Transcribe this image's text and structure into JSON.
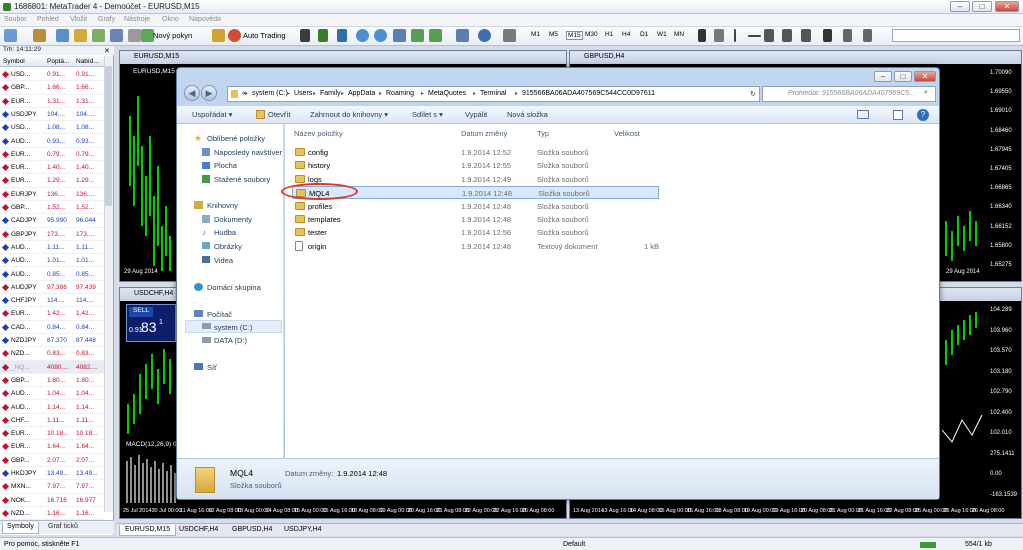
{
  "window": {
    "title": "1686801: MetaTrader 4 - Demoúčet - EURUSD,M15",
    "min": "–",
    "max": "□",
    "close": "✕"
  },
  "menu": [
    "Soubor",
    "Pohled",
    "Vložit",
    "Grafy",
    "Nástroje",
    "Okno",
    "Nápověda"
  ],
  "toolbar": {
    "new_order": "Nový pokyn",
    "auto_trading": "Auto Trading",
    "timeframes": [
      "M1",
      "M5",
      "M15",
      "M30",
      "H1",
      "H4",
      "D1",
      "W1",
      "MN"
    ]
  },
  "market_watch": {
    "header": "Trh: 14:11:29",
    "columns": [
      "Symbol",
      "Poptá...",
      "Nabíd..."
    ],
    "rows": [
      {
        "sym": "USD...",
        "bid": "0.91...",
        "ask": "0.91...",
        "c": "#c8102e"
      },
      {
        "sym": "GBP...",
        "bid": "1.66...",
        "ask": "1.66...",
        "c": "#c8102e"
      },
      {
        "sym": "EUR...",
        "bid": "1.31...",
        "ask": "1.31...",
        "c": "#c8102e"
      },
      {
        "sym": "USDJPY",
        "bid": "104....",
        "ask": "104....",
        "c": "#1a3fbf"
      },
      {
        "sym": "USD...",
        "bid": "1.08...",
        "ask": "1.08...",
        "c": "#1a3fbf"
      },
      {
        "sym": "AUD...",
        "bid": "0.93...",
        "ask": "0.93...",
        "c": "#1a3fbf"
      },
      {
        "sym": "EUR...",
        "bid": "0.79...",
        "ask": "0.79...",
        "c": "#c8102e"
      },
      {
        "sym": "EUR...",
        "bid": "1.40...",
        "ask": "1.40...",
        "c": "#c8102e"
      },
      {
        "sym": "EUR...",
        "bid": "1.29...",
        "ask": "1.29...",
        "c": "#c8102e"
      },
      {
        "sym": "EURJPY",
        "bid": "136....",
        "ask": "136....",
        "c": "#c8102e"
      },
      {
        "sym": "GBP...",
        "bid": "1.52...",
        "ask": "1.52...",
        "c": "#c8102e"
      },
      {
        "sym": "CADJPY",
        "bid": "95.990",
        "ask": "96.044",
        "c": "#1a3fbf"
      },
      {
        "sym": "GBPJPY",
        "bid": "173....",
        "ask": "173....",
        "c": "#c8102e"
      },
      {
        "sym": "AUD...",
        "bid": "1.11...",
        "ask": "1.11...",
        "c": "#1a3fbf"
      },
      {
        "sym": "AUD...",
        "bid": "1.01...",
        "ask": "1.01...",
        "c": "#1a3fbf"
      },
      {
        "sym": "AUD...",
        "bid": "0.85...",
        "ask": "0.85...",
        "c": "#1a3fbf"
      },
      {
        "sym": "AUDJPY",
        "bid": "97.386",
        "ask": "97.439",
        "c": "#c8102e"
      },
      {
        "sym": "CHFJPY",
        "bid": "114....",
        "ask": "114....",
        "c": "#1a3fbf"
      },
      {
        "sym": "EUR...",
        "bid": "1.42...",
        "ask": "1.42...",
        "c": "#c8102e"
      },
      {
        "sym": "CAD...",
        "bid": "0.84...",
        "ask": "0.84...",
        "c": "#1a3fbf"
      },
      {
        "sym": "NZDJPY",
        "bid": "87.370",
        "ask": "87.448",
        "c": "#1a3fbf"
      },
      {
        "sym": "NZD...",
        "bid": "0.83...",
        "ask": "0.83...",
        "c": "#c8102e"
      },
      {
        "sym": "_NQ...",
        "bid": "4080....",
        "ask": "4082....",
        "c": "#c8102e"
      },
      {
        "sym": "GBP...",
        "bid": "1.80...",
        "ask": "1.80...",
        "c": "#c8102e"
      },
      {
        "sym": "AUD...",
        "bid": "1.04...",
        "ask": "1.04...",
        "c": "#c8102e"
      },
      {
        "sym": "AUD...",
        "bid": "1.14...",
        "ask": "1.14...",
        "c": "#c8102e"
      },
      {
        "sym": "CHF...",
        "bid": "1.11...",
        "ask": "1.11...",
        "c": "#c8102e"
      },
      {
        "sym": "EUR...",
        "bid": "10.18...",
        "ask": "10.18...",
        "c": "#c8102e"
      },
      {
        "sym": "EUR...",
        "bid": "1.64...",
        "ask": "1.64...",
        "c": "#c8102e"
      },
      {
        "sym": "GBP...",
        "bid": "2.07...",
        "ask": "2.07...",
        "c": "#c8102e"
      },
      {
        "sym": "HKDJPY",
        "bid": "13.49...",
        "ask": "13.49...",
        "c": "#1a3fbf"
      },
      {
        "sym": "MXN...",
        "bid": "7.97...",
        "ask": "7.97...",
        "c": "#c8102e"
      },
      {
        "sym": "NOK...",
        "bid": "16.716",
        "ask": "16.977",
        "c": "#c8102e"
      },
      {
        "sym": "NZD...",
        "bid": "1.16...",
        "ask": "1.16...",
        "c": "#c8102e"
      }
    ],
    "tabs": [
      "Symboly",
      "Graf ticků"
    ]
  },
  "charts": {
    "eurusd": {
      "title": "EURUSD,M15",
      "tag": "EURUSD,M15",
      "date": "29 Aug 2014"
    },
    "gbpusd": {
      "title": "GBPUSD,H4",
      "date": "29 Aug 2014",
      "prices": [
        "1.70090",
        "1.69550",
        "1.69010",
        "1.68460",
        "1.67945",
        "1.67405",
        "1.66865",
        "1.66340",
        "1.66152",
        "1.65800",
        "1.65275"
      ]
    },
    "usdchf": {
      "title": "USDCHF,H4",
      "sell": "SELL",
      "price_main": "0.91",
      "price_big": "83",
      "price_sup": "1",
      "macd": "MACD(12,26,9) 0.00"
    },
    "usdjpy": {
      "prices": [
        "104.289",
        "103.960",
        "103.570",
        "103.180",
        "102.790",
        "102.400",
        "102.010",
        "275.1411",
        "0.00",
        "-163.1539"
      ]
    },
    "bottom_axis_left": [
      "25 Jul 2014",
      "30 Jul 00:00",
      "11 Aug 16:00",
      "12 Aug 08:00",
      "13 Aug 00:00",
      "14 Aug 08:00",
      "15 Aug 00:00",
      "15 Aug 16:00",
      "18 Aug 08:00",
      "19 Aug 00:00",
      "20 Aug 16:00",
      "21 Aug 08:00",
      "22 Aug 00:00",
      "22 Aug 16:00",
      "25 Aug 08:00"
    ],
    "bottom_axis_right": [
      "13 Aug 2014",
      "13 Aug 16:00",
      "14 Aug 08:00",
      "15 Aug 00:00",
      "15 Aug 16:00",
      "18 Aug 08:00",
      "19 Aug 00:00",
      "19 Aug 16:00",
      "20 Aug 08:00",
      "21 Aug 00:00",
      "21 Aug 16:00",
      "22 Aug 08:00",
      "25 Aug 00:00",
      "25 Aug 16:00",
      "26 Aug 08:00"
    ]
  },
  "chart_tabs": [
    "EURUSD,M15",
    "USDCHF,H4",
    "GBPUSD,H4",
    "USDJPY,H4"
  ],
  "explorer": {
    "path": [
      "«",
      "system (C:)",
      "Users",
      "Family",
      "AppData",
      "Roaming",
      "MetaQuotes",
      "Terminal",
      "915566BA06ADA407569C544CC0D97611"
    ],
    "search_placeholder": "Prohledat: 915566BA06ADA407569C5...",
    "commands": [
      "Uspořádat ▾",
      "Otevřít",
      "Zahrnout do knihovny ▾",
      "Sdílet s ▾",
      "Vypálit",
      "Nová složka"
    ],
    "nav": {
      "favorites": "Oblíbené položky",
      "fav_items": [
        "Naposledy navštíver",
        "Plocha",
        "Stažené soubory"
      ],
      "libraries": "Knihovny",
      "lib_items": [
        "Dokumenty",
        "Hudba",
        "Obrázky",
        "Videa"
      ],
      "homegroup": "Domácí skupina",
      "computer": "Počítač",
      "drives": [
        "system (C:)",
        "DATA (D:)"
      ],
      "network": "Síť"
    },
    "columns": [
      "Název položky",
      "Datum změny",
      "Typ",
      "Velikost"
    ],
    "files": [
      {
        "name": "config",
        "date": "1.9.2014 12:52",
        "type": "Složka souborů",
        "size": "",
        "folder": true
      },
      {
        "name": "history",
        "date": "1.9.2014 12:55",
        "type": "Složka souborů",
        "size": "",
        "folder": true
      },
      {
        "name": "logs",
        "date": "1.9.2014 12:49",
        "type": "Složka souborů",
        "size": "",
        "folder": true
      },
      {
        "name": "MQL4",
        "date": "1.9.2014 12:48",
        "type": "Složka souborů",
        "size": "",
        "folder": true
      },
      {
        "name": "profiles",
        "date": "1.9.2014 12:48",
        "type": "Složka souborů",
        "size": "",
        "folder": true
      },
      {
        "name": "templates",
        "date": "1.9.2014 12:48",
        "type": "Složka souborů",
        "size": "",
        "folder": true
      },
      {
        "name": "tester",
        "date": "1.9.2014 12:56",
        "type": "Složka souborů",
        "size": "",
        "folder": true
      },
      {
        "name": "origin",
        "date": "1.9.2014 12:48",
        "type": "Textový dokument",
        "size": "1 kB",
        "folder": false
      }
    ],
    "details": {
      "name": "MQL4",
      "label": "Datum změny:",
      "date": "1.9.2014 12:48",
      "type": "Složka souborů"
    }
  },
  "status": {
    "help": "Pro pomoc, stiskněte F1",
    "profile": "Default",
    "traffic": "554/1 kb"
  }
}
